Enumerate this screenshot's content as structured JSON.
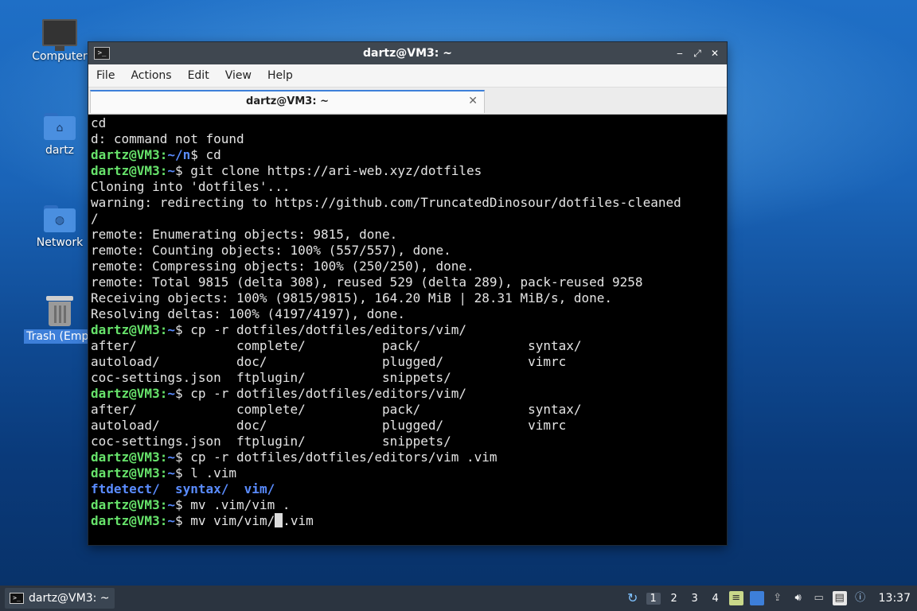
{
  "desktop": {
    "icons": [
      {
        "label": "Computer"
      },
      {
        "label": "dartz"
      },
      {
        "label": "Network"
      },
      {
        "label": "Trash (Empt"
      }
    ]
  },
  "window": {
    "title": "dartz@VM3: ~",
    "menu": [
      "File",
      "Actions",
      "Edit",
      "View",
      "Help"
    ],
    "tab_label": "dartz@VM3: ~",
    "controls": {
      "minimize": "‒",
      "maximize": "⤢",
      "close": "✕"
    }
  },
  "terminal": {
    "prompt_user": "dartz@VM3",
    "prompt_home": "~",
    "prompt_n": "~/n",
    "lines": [
      {
        "t": "text",
        "v": "cd"
      },
      {
        "t": "text",
        "v": "d: command not found"
      },
      {
        "t": "prompt",
        "path": "~/n",
        "cmd": "$ cd"
      },
      {
        "t": "prompt",
        "path": "~",
        "cmd": "$ git clone https://ari-web.xyz/dotfiles"
      },
      {
        "t": "text",
        "v": "Cloning into 'dotfiles'..."
      },
      {
        "t": "text",
        "v": "warning: redirecting to https://github.com/TruncatedDinosour/dotfiles-cleaned"
      },
      {
        "t": "text",
        "v": "/"
      },
      {
        "t": "text",
        "v": "remote: Enumerating objects: 9815, done."
      },
      {
        "t": "text",
        "v": "remote: Counting objects: 100% (557/557), done."
      },
      {
        "t": "text",
        "v": "remote: Compressing objects: 100% (250/250), done."
      },
      {
        "t": "text",
        "v": "remote: Total 9815 (delta 308), reused 529 (delta 289), pack-reused 9258"
      },
      {
        "t": "text",
        "v": "Receiving objects: 100% (9815/9815), 164.20 MiB | 28.31 MiB/s, done."
      },
      {
        "t": "text",
        "v": "Resolving deltas: 100% (4197/4197), done."
      },
      {
        "t": "prompt",
        "path": "~",
        "cmd": "$ cp -r dotfiles/dotfiles/editors/vim/"
      },
      {
        "t": "text",
        "v": "after/             complete/          pack/              syntax/"
      },
      {
        "t": "text",
        "v": "autoload/          doc/               plugged/           vimrc"
      },
      {
        "t": "text",
        "v": "coc-settings.json  ftplugin/          snippets/"
      },
      {
        "t": "prompt",
        "path": "~",
        "cmd": "$ cp -r dotfiles/dotfiles/editors/vim/"
      },
      {
        "t": "text",
        "v": "after/             complete/          pack/              syntax/"
      },
      {
        "t": "text",
        "v": "autoload/          doc/               plugged/           vimrc"
      },
      {
        "t": "text",
        "v": "coc-settings.json  ftplugin/          snippets/"
      },
      {
        "t": "prompt",
        "path": "~",
        "cmd": "$ cp -r dotfiles/dotfiles/editors/vim .vim"
      },
      {
        "t": "prompt",
        "path": "~",
        "cmd": "$ l .vim"
      },
      {
        "t": "dirs",
        "v": [
          "ftdetect/",
          "syntax/",
          "vim/"
        ]
      },
      {
        "t": "prompt",
        "path": "~",
        "cmd": "$ mv .vim/vim ."
      },
      {
        "t": "prompt_cursor",
        "path": "~",
        "cmd_before": "$ mv vim/vim/",
        "cmd_after": ".vim"
      }
    ]
  },
  "taskbar": {
    "task_label": "dartz@VM3: ~",
    "workspaces": [
      "1",
      "2",
      "3",
      "4"
    ],
    "active_workspace": "1",
    "clock": "13:37"
  },
  "colors": {
    "prompt_user": "#67e36b",
    "prompt_path": "#5a8cff",
    "directory": "#5a8cff",
    "selection": "#3d7fd9"
  }
}
